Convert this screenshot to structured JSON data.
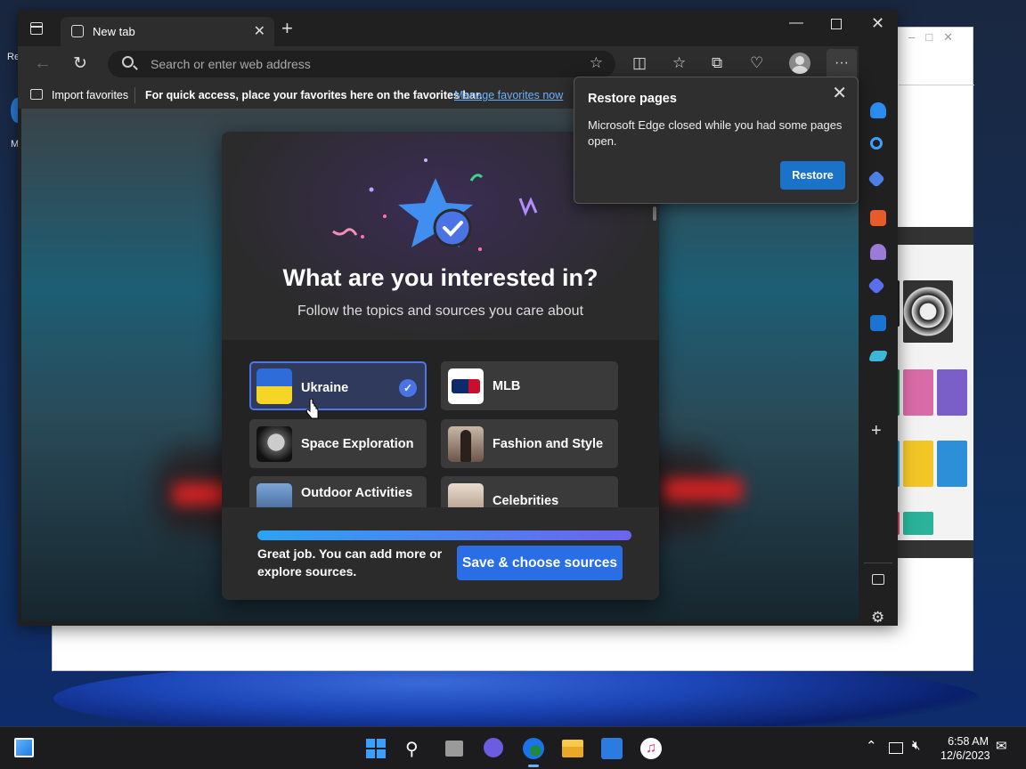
{
  "desktop": {
    "icon_label_1": "Re",
    "icon_label_2": "M"
  },
  "browser": {
    "tab": {
      "title": "New tab"
    },
    "address": {
      "placeholder": "Search or enter web address"
    },
    "favorites_bar": {
      "import_label": "Import favorites",
      "message": "For quick access, place your favorites here on the favorites bar.",
      "manage_link": "Manage favorites now"
    }
  },
  "interest_dialog": {
    "heading": "What are you interested in?",
    "subheading": "Follow the topics and sources you care about",
    "topics": [
      {
        "label": "Ukraine",
        "selected": true
      },
      {
        "label": "MLB",
        "selected": false
      },
      {
        "label": "Space Exploration",
        "selected": false
      },
      {
        "label": "Fashion and Style",
        "selected": false
      },
      {
        "label": "Outdoor Activities",
        "selected": false
      },
      {
        "label": "Celebrities",
        "selected": false
      }
    ],
    "progress": 1.0,
    "footer_text": "Great job. You can add more or explore sources.",
    "save_button": "Save & choose sources"
  },
  "restore_popup": {
    "title": "Restore pages",
    "body": "Microsoft Edge closed while you had some pages open.",
    "button": "Restore"
  },
  "taskbar": {
    "time": "6:58 AM",
    "date": "12/6/2023"
  },
  "colors": {
    "accent": "#2a6ee6",
    "restore_button": "#1a73c9",
    "link": "#6ab2ff"
  }
}
